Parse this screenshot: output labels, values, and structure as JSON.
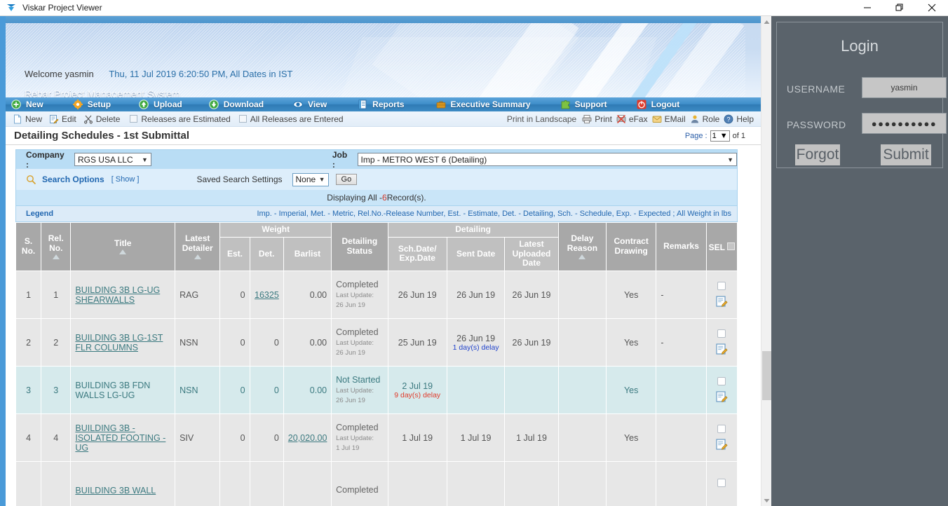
{
  "window": {
    "title": "Viskar Project Viewer",
    "minimize_icon": "minimize-icon",
    "maximize_icon": "maximize-icon",
    "close_icon": "close-icon"
  },
  "banner": {
    "welcome": "Welcome yasmin",
    "datetime": "Thu, 11 Jul 2019 6:20:50 PM, All Dates in IST",
    "system_name": "Rebar Project Management System"
  },
  "menu": [
    {
      "label": "New",
      "icon": "plus-circle-icon"
    },
    {
      "label": "Setup",
      "icon": "gear-icon"
    },
    {
      "label": "Upload",
      "icon": "upload-arrow-icon"
    },
    {
      "label": "Download",
      "icon": "download-arrow-icon"
    },
    {
      "label": "View",
      "icon": "eye-icon"
    },
    {
      "label": "Reports",
      "icon": "report-book-icon"
    },
    {
      "label": "Executive Summary",
      "icon": "briefcase-icon"
    },
    {
      "label": "Support",
      "icon": "puzzle-icon"
    },
    {
      "label": "Logout",
      "icon": "power-icon"
    }
  ],
  "actionbar": {
    "new": "New",
    "edit": "Edit",
    "delete": "Delete",
    "releases_estimated": "Releases are Estimated",
    "all_releases_entered": "All Releases are Entered",
    "print_landscape": "Print in Landscape",
    "print": "Print",
    "efax": "eFax",
    "email": "EMail",
    "role": "Role",
    "help": "Help"
  },
  "page": {
    "title": "Detailing Schedules - 1st Submittal",
    "page_label": "Page :",
    "page_value": "1",
    "page_of": "of  1"
  },
  "filters": {
    "company_label": "Company :",
    "company_value": "RGS USA LLC",
    "job_label": "Job :",
    "job_value": "Imp -   METRO WEST 6 (Detailing)",
    "search_options": "Search Options",
    "search_show": "[ Show ]",
    "saved_search_label": "Saved Search Settings",
    "saved_search_value": "None",
    "go_button": "Go",
    "displaying_prefix": "Displaying All - ",
    "displaying_count": "6",
    "displaying_suffix": " Record(s).",
    "legend_label": "Legend",
    "legend_text": "Imp. - Imperial, Met. - Metric, Rel.No.-Release Number, Est. - Estimate, Det. - Detailing, Sch. - Schedule, Exp. - Expected ; All Weight in lbs"
  },
  "table": {
    "headers": {
      "s_no": "S. No.",
      "rel_no": "Rel. No.",
      "title": "Title",
      "latest_detailer": "Latest Detailer",
      "weight": "Weight",
      "est": "Est.",
      "det": "Det.",
      "barlist": "Barlist",
      "detailing_status": "Detailing Status",
      "detailing": "Detailing",
      "sch_exp_date": "Sch.Date/ Exp.Date",
      "sent_date": "Sent Date",
      "latest_uploaded_date": "Latest Uploaded Date",
      "delay_reason": "Delay Reason",
      "contract_drawing": "Contract Drawing",
      "remarks": "Remarks",
      "sel": "SEL"
    },
    "rows": [
      {
        "s_no": "1",
        "rel_no": "1",
        "title": "BUILDING 3B LG-UG SHEARWALLS ",
        "title_link": true,
        "detailer": "RAG",
        "est": "0",
        "det": "16325",
        "det_link": true,
        "barlist": "0.00",
        "barlist_link": false,
        "status": "Completed",
        "status_update_label": "Last Update:",
        "status_update_date": "26 Jun 19",
        "sch_date": "26 Jun 19",
        "sch_delay": "",
        "sent_date": "26 Jun 19",
        "sent_delay": "",
        "uploaded_date": "26 Jun 19",
        "delay_reason": "",
        "contract_drawing": "Yes",
        "remarks": "-",
        "highlight": false
      },
      {
        "s_no": "2",
        "rel_no": "2",
        "title": "BUILDING 3B LG-1ST FLR COLUMNS ",
        "title_link": true,
        "detailer": "NSN",
        "est": "0",
        "det": "0",
        "det_link": false,
        "barlist": "0.00",
        "barlist_link": false,
        "status": "Completed",
        "status_update_label": "Last Update:",
        "status_update_date": "26 Jun 19",
        "sch_date": "25 Jun 19",
        "sch_delay": "",
        "sent_date": "26 Jun 19",
        "sent_delay": "1 day(s) delay",
        "uploaded_date": "26 Jun 19",
        "delay_reason": "",
        "contract_drawing": "Yes",
        "remarks": "-",
        "highlight": false
      },
      {
        "s_no": "3",
        "rel_no": "3",
        "title": "BUILDING 3B FDN WALLS LG-UG",
        "title_link": false,
        "detailer": "NSN",
        "est": "0",
        "det": "0",
        "det_link": false,
        "barlist": "0.00",
        "barlist_link": false,
        "status": "Not Started",
        "status_update_label": "Last Update:",
        "status_update_date": "26 Jun 19",
        "sch_date": "2 Jul 19",
        "sch_delay": "9 day(s) delay",
        "sent_date": "",
        "sent_delay": "",
        "uploaded_date": "",
        "delay_reason": "",
        "contract_drawing": "Yes",
        "remarks": "",
        "highlight": true
      },
      {
        "s_no": "4",
        "rel_no": "4",
        "title": "BUILDING 3B - ISOLATED FOOTING -UG ",
        "title_link": true,
        "detailer": "SIV",
        "est": "0",
        "det": "0",
        "det_link": false,
        "barlist": "20,020.00",
        "barlist_link": true,
        "status": "Completed",
        "status_update_label": "Last Update:",
        "status_update_date": "1 Jul 19",
        "sch_date": "1 Jul 19",
        "sch_delay": "",
        "sent_date": "1 Jul 19",
        "sent_delay": "",
        "uploaded_date": "1 Jul 19",
        "delay_reason": "",
        "contract_drawing": "Yes",
        "remarks": "",
        "highlight": false
      },
      {
        "s_no": "",
        "rel_no": "",
        "title": "BUILDING 3B WALL",
        "title_link": false,
        "detailer": "",
        "est": "",
        "det": "",
        "det_link": false,
        "barlist": "",
        "barlist_link": false,
        "status": "Completed",
        "status_update_label": "",
        "status_update_date": "",
        "sch_date": "",
        "sch_delay": "",
        "sent_date": "",
        "sent_delay": "",
        "uploaded_date": "",
        "delay_reason": "",
        "contract_drawing": "",
        "remarks": "",
        "highlight": false
      }
    ]
  },
  "login": {
    "title": "Login",
    "username_label": "USERNAME",
    "username_value": "yasmin",
    "password_label": "PASSWORD",
    "password_value": "●●●●●●●●●●",
    "forgot_button": "Forgot",
    "submit_button": "Submit"
  },
  "colors": {
    "accent_blue": "#4a9ad8",
    "link_blue": "#2167b0",
    "highlight_row": "#d6eaec",
    "delay_red": "#e03b2b",
    "delay_blue": "#2244cc",
    "login_bg": "#5a636b"
  }
}
